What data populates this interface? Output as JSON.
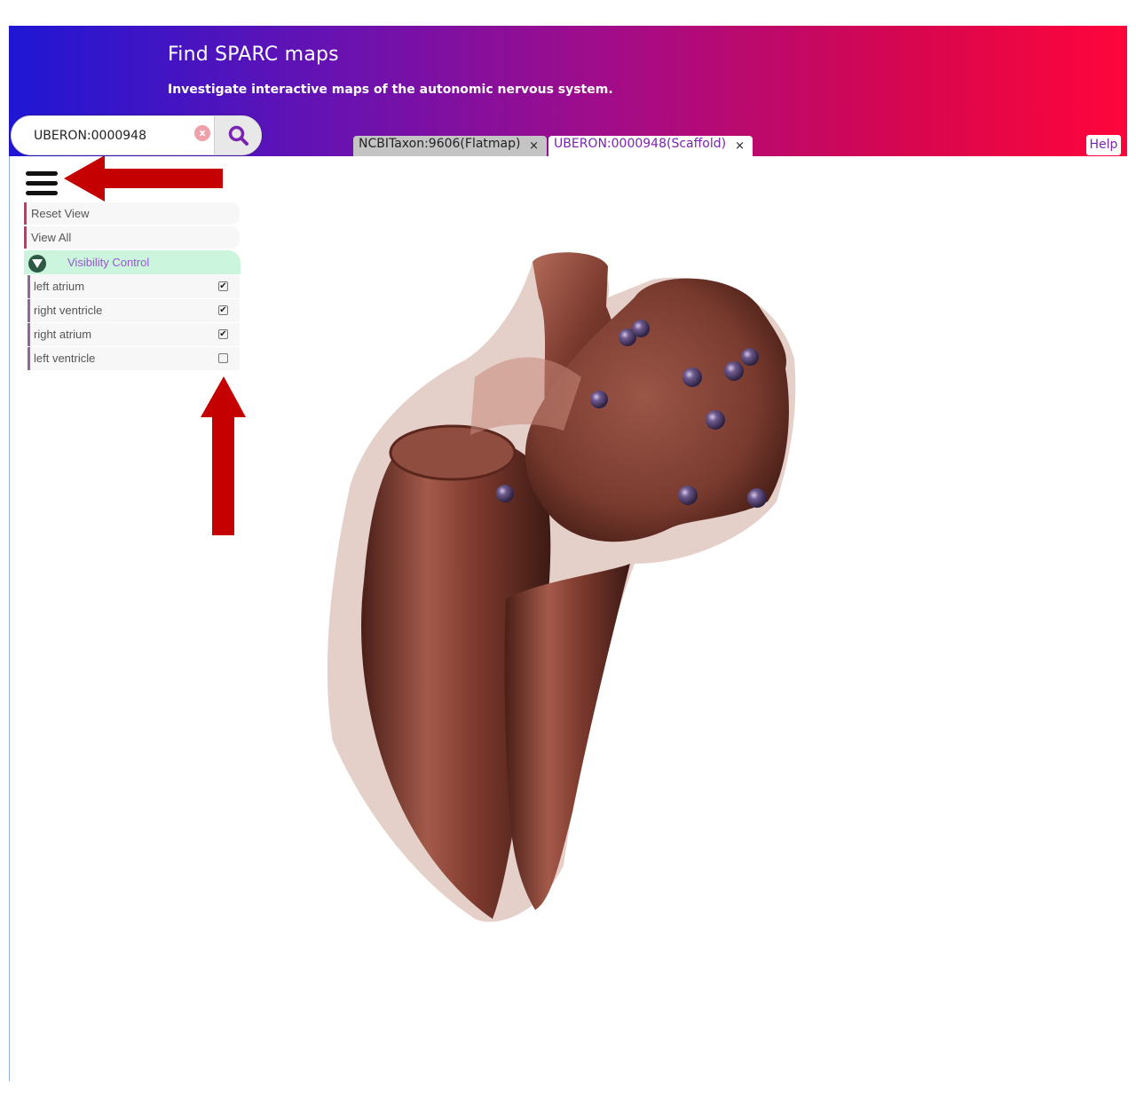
{
  "header": {
    "title": "Find SPARC maps",
    "subtitle": "Investigate interactive maps of the autonomic nervous system."
  },
  "search": {
    "value": "UBERON:0000948",
    "clear_label": "x"
  },
  "tabs": [
    {
      "label": "NCBITaxon:9606(Flatmap)",
      "close": "×",
      "active": false
    },
    {
      "label": "UBERON:0000948(Scaffold)",
      "close": "×",
      "active": true
    }
  ],
  "help_label": "Help",
  "menu": {
    "reset_view": "Reset View",
    "view_all": "View All"
  },
  "visibility": {
    "title": "Visibility Control",
    "items": [
      {
        "label": "left atrium",
        "checked": true
      },
      {
        "label": "right ventricle",
        "checked": true
      },
      {
        "label": "right atrium",
        "checked": true
      },
      {
        "label": "left ventricle",
        "checked": false
      }
    ]
  },
  "colors": {
    "accent": "#7a23b2",
    "annotation_arrow": "#c50000",
    "heart_tissue": "#7a3b2e",
    "marker": "#4b3a66"
  }
}
